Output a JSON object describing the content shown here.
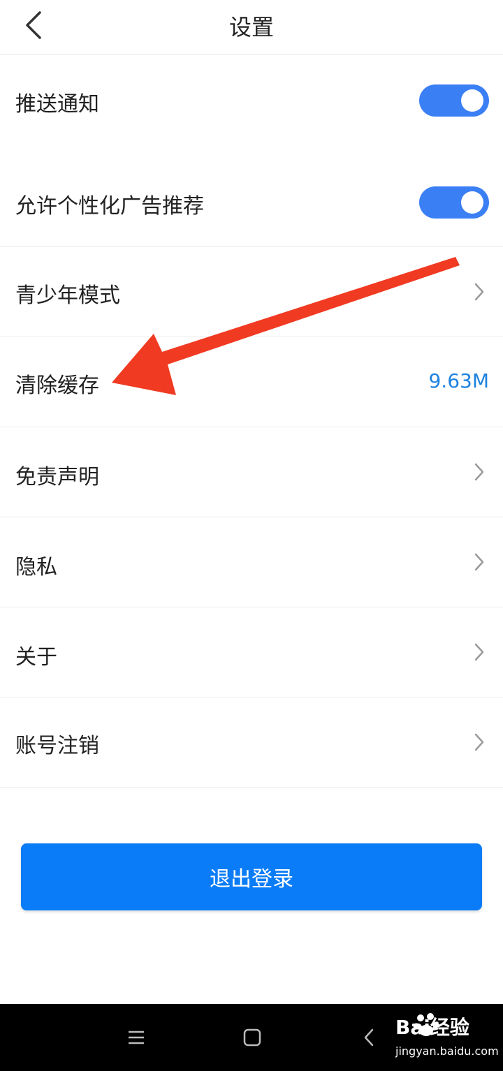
{
  "header": {
    "title": "设置"
  },
  "settings": {
    "push_notification": {
      "label": "推送通知",
      "enabled": true
    },
    "personalized_ads": {
      "label": "允许个性化广告推荐",
      "enabled": true
    },
    "teen_mode": {
      "label": "青少年模式"
    },
    "clear_cache": {
      "label": "清除缓存",
      "value": "9.63M"
    },
    "disclaimer": {
      "label": "免责声明"
    },
    "privacy": {
      "label": "隐私"
    },
    "about": {
      "label": "关于"
    },
    "account_deletion": {
      "label": "账号注销"
    }
  },
  "logout_button": {
    "label": "退出登录"
  },
  "watermark": {
    "brand": "Bai经验",
    "url": "jingyan.baidu.com"
  },
  "colors": {
    "accent": "#3b7ff5",
    "button": "#0a7cf7",
    "value_text": "#1f83e0",
    "annotation_arrow": "#f03a22",
    "chevron": "#9a9a9a"
  },
  "icons": [
    "back-arrow-icon",
    "chevron-right-icon",
    "menu-icon",
    "home-icon",
    "back-icon",
    "baidu-paw-icon"
  ]
}
